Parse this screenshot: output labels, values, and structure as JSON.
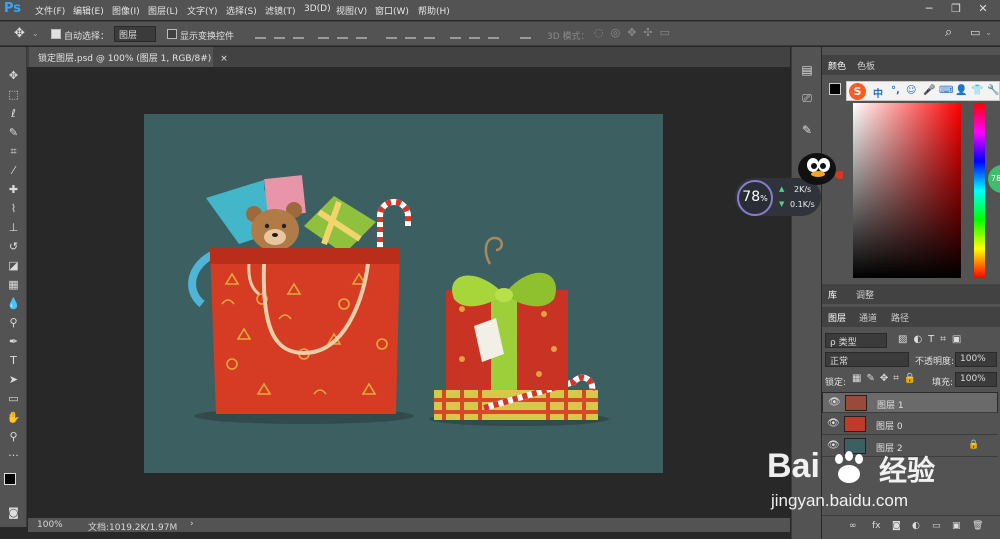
{
  "menu": {
    "logo": "Ps",
    "items": [
      "文件(F)",
      "编辑(E)",
      "图像(I)",
      "图层(L)",
      "文字(Y)",
      "选择(S)",
      "滤镜(T)",
      "3D(D)",
      "视图(V)",
      "窗口(W)",
      "帮助(H)"
    ],
    "minimize": "─",
    "restore": "❐",
    "close": "✕"
  },
  "options": {
    "auto_select_label": "自动选择：",
    "auto_select_value": "图层",
    "show_transform_label": "显示变换控件",
    "mode_3d_label": "3D 模式："
  },
  "document": {
    "tab_title": "锁定图层.psd @ 100% (图层 1, RGB/8#)",
    "tab_close": "×"
  },
  "status": {
    "zoom": "100%",
    "doc_size": "文档:1019.2K/1.97M",
    "arrow": "›"
  },
  "color_panel": {
    "tabs": [
      "颜色",
      "色板"
    ]
  },
  "lib_panel": {
    "tabs": [
      "库",
      "调整"
    ]
  },
  "layers_panel": {
    "tabs": [
      "图层",
      "通道",
      "路径"
    ],
    "filter_label": "ρ 类型",
    "blend_mode": "正常",
    "opacity_label": "不透明度:",
    "opacity_value": "100%",
    "lock_label": "锁定:",
    "fill_label": "填充:",
    "fill_value": "100%",
    "layers": [
      {
        "name": "图层 1",
        "selected": true,
        "thumb_color": "#9a4a3a"
      },
      {
        "name": "图层 0",
        "selected": false,
        "thumb_color": "#c0392b"
      },
      {
        "name": "图层 2",
        "selected": false,
        "thumb_color": "#3c5f61",
        "locked": true
      }
    ],
    "footer_icons": [
      "∞",
      "fx",
      "◙",
      "◐",
      "▭",
      "▣",
      "🗑"
    ]
  },
  "net_widget": {
    "percent": "78",
    "percent_unit": "%",
    "up": "2K/s",
    "down": "0.1K/s"
  },
  "ime": {
    "logo": "S",
    "mode": "中",
    "punct": "°,",
    "icons": [
      "☺",
      "🎤",
      "⌨",
      "👤",
      "👕",
      "🔧"
    ]
  },
  "edge_badge": "78",
  "watermark": {
    "brand": "Bai",
    "brand2": "经验",
    "url": "jingyan.baidu.com"
  },
  "colors": {
    "chrome": "#535353",
    "canvas_bg": "#3c5f61",
    "workspace": "#282828",
    "accent_blue": "#31a8ff",
    "bag_red": "#d63b24"
  }
}
